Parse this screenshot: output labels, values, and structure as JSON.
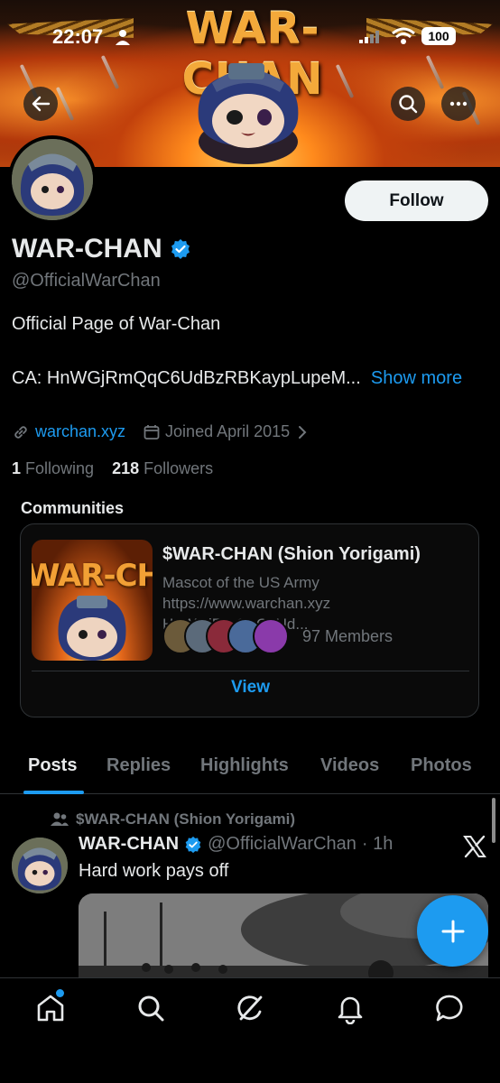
{
  "status_bar": {
    "time": "22:07",
    "battery": "100"
  },
  "banner": {
    "title": "WAR-CHAN"
  },
  "profile": {
    "follow_label": "Follow",
    "display_name": "WAR-CHAN",
    "handle": "@OfficialWarChan",
    "bio": "Official Page of War-Chan",
    "ca_text": "CA: HnWGjRmQqC6UdBzRBKaypLupeM...",
    "show_more": "Show more",
    "website": "warchan.xyz",
    "joined": "Joined April 2015",
    "following_count": "1",
    "following_label": "Following",
    "followers_count": "218",
    "followers_label": "Followers"
  },
  "communities": {
    "section_title": "Communities",
    "card": {
      "image_title": "WAR-CHAN",
      "name": "$WAR-CHAN (Shion Yorigami)",
      "description": "Mascot of the US Army https://www.warchan.xyz HnWGjRmQqC6Ud...",
      "members": "97 Members",
      "view_label": "View"
    }
  },
  "tabs": [
    "Posts",
    "Replies",
    "Highlights",
    "Videos",
    "Photos"
  ],
  "post": {
    "community": "$WAR-CHAN (Shion Yorigami)",
    "author": "WAR-CHAN",
    "handle": "@OfficialWarChan",
    "time": "· 1h",
    "text": "Hard work pays off"
  },
  "colors": {
    "accent": "#1d9bf0",
    "background": "#000000",
    "text_primary": "#e7e9ea",
    "text_secondary": "#71767b",
    "border": "#2f3336"
  },
  "icons": {
    "back": "arrow-left-icon",
    "search": "search-icon",
    "more": "more-horizontal-icon",
    "verified": "verified-badge-icon",
    "link": "link-icon",
    "calendar": "calendar-icon",
    "community": "people-icon",
    "x_logo": "x-logo-icon",
    "compose": "plus-icon",
    "nav": [
      "home-icon",
      "search-icon",
      "grok-icon",
      "bell-icon",
      "messages-icon"
    ]
  }
}
